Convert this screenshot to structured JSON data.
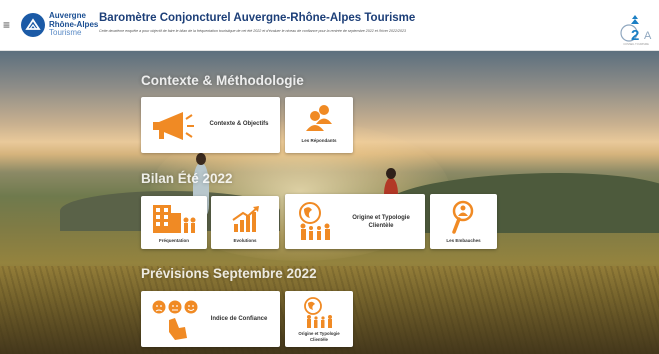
{
  "header": {
    "logo_line1": "Auvergne",
    "logo_line2": "Rhône-Alpes",
    "logo_line3": "Tourisme",
    "title": "Baromètre Conjoncturel Auvergne-Rhône-Alpes Tourisme",
    "subtitle": "Cette deuxième enquête a pour objectif de faire le bilan de la fréquentation touristique de cet été 2022 et d'évaluer le niveau de confiance pour la rentrée de septembre 2022 et l'hiver 2022/2023",
    "partner_logo_text": "C2A",
    "partner_caption": "CONSEIL TOURISME"
  },
  "sections": {
    "contexte": "Contexte & Méthodologie",
    "bilan": "Bilan Été 2022",
    "previsions": "Prévisions Septembre 2022"
  },
  "cards": {
    "contexte_objectifs": "Contexte & Objectifs",
    "repondants": "Les Répondants",
    "frequentation": "Fréquentation",
    "evolutions": "Evolutions",
    "origine_typologie": [
      "Origine et Typologie",
      "Clientèle"
    ],
    "embauches": "Les Embauches",
    "indice_confiance": "Indice de Confiance",
    "origine_typologie_small": [
      "Origine et Typologie",
      "Clientèle"
    ]
  },
  "colors": {
    "accent_orange": "#f08a24",
    "title_blue": "#1d3f78",
    "logo_blue": "#1b5aa6"
  },
  "icons": {
    "menu": "≡"
  }
}
